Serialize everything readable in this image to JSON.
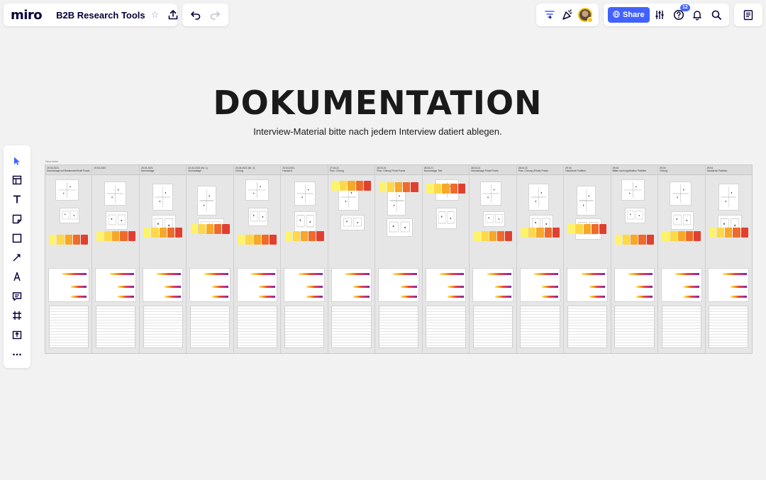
{
  "app": {
    "logo": "miro",
    "board_title": "B2B Research Tools"
  },
  "header": {
    "share_label": "Share",
    "notifications_badge": "12"
  },
  "canvas": {
    "title": "DOKUMENTATION",
    "subtitle": "Interview-Material bitte nach jedem Interview datiert ablegen.",
    "frame_label": "New table",
    "columns": [
      {
        "date": "19.04.2021",
        "topic": "Normanlage mit Bestimmter/Kraft Praxis"
      },
      {
        "date": "19.04.2021",
        "topic": ""
      },
      {
        "date": "20.04.2021",
        "topic": "Normanlage"
      },
      {
        "date": "22.04.2021 (Nr. 1)",
        "topic": "Normanlage"
      },
      {
        "date": "22.04.2021 (Nr. 2)",
        "topic": "Chirurg"
      },
      {
        "date": "23.04.2021",
        "topic": "Hausarzt"
      },
      {
        "date": "27.04.21",
        "topic": "Prax. Chirurg"
      },
      {
        "date": "28.04.21",
        "topic": "Prax. Chirurg Privat Praxis"
      },
      {
        "date": "28.04.21",
        "topic": "Normanlage Test"
      },
      {
        "date": "28.04.21",
        "topic": "Normanlage Privat Praxis"
      },
      {
        "date": "28.04.21",
        "topic": "Prax. Chirurg (Privat) Praxis"
      },
      {
        "date": "29.04",
        "topic": "Hausärzte Partition"
      },
      {
        "date": "29.04",
        "topic": "Bitten nach Applikation Partition"
      },
      {
        "date": "29.04",
        "topic": "Chirurg"
      },
      {
        "date": "29.04",
        "topic": "Hausärzte Partition"
      }
    ]
  },
  "colors": {
    "accent": "#4262ff",
    "canvas_bg": "#f2f2f2",
    "strip": [
      "#fff36b",
      "#ffd84a",
      "#f7a829",
      "#ef6b2c",
      "#e0402f"
    ]
  }
}
